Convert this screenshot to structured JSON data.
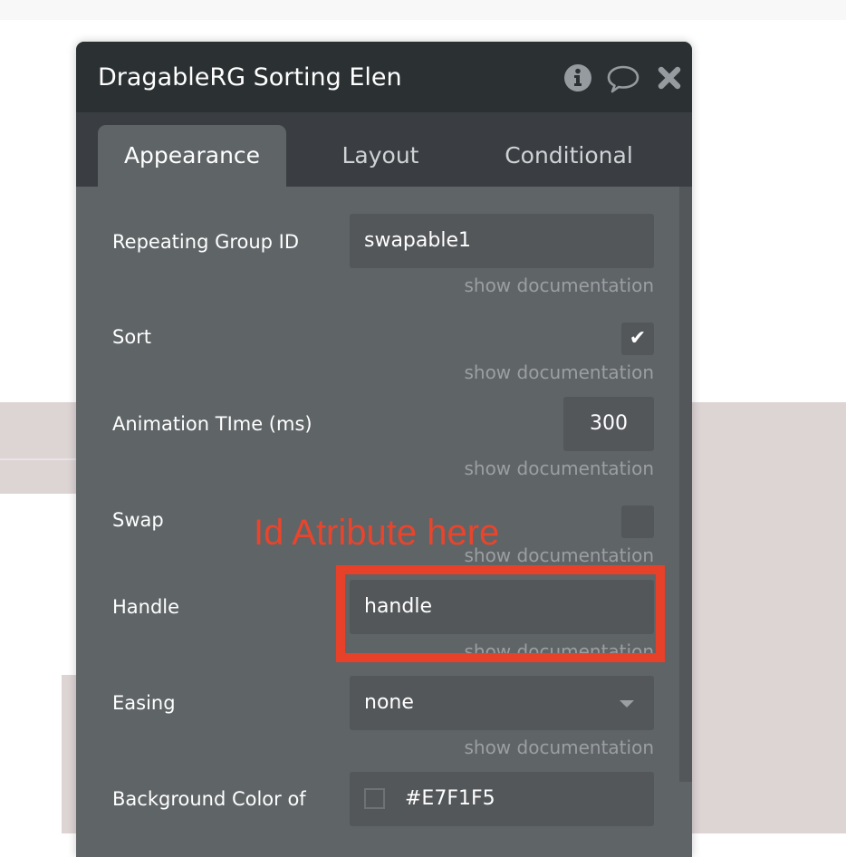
{
  "window": {
    "title": "DragableRG Sorting Elen",
    "header_icons": [
      "info-icon",
      "comment-icon",
      "close-icon"
    ]
  },
  "tabs": [
    {
      "label": "Appearance",
      "active": true
    },
    {
      "label": "Layout",
      "active": false
    },
    {
      "label": "Conditional",
      "active": false
    }
  ],
  "fields": {
    "repeating_group_id": {
      "label": "Repeating Group ID",
      "value": "swapable1",
      "doc": "show documentation"
    },
    "sort": {
      "label": "Sort",
      "checked": true,
      "doc": "show documentation"
    },
    "animation_time": {
      "label": "Animation TIme (ms)",
      "value": "300",
      "doc": "show documentation"
    },
    "swap": {
      "label": "Swap",
      "checked": false,
      "doc": "show documentation"
    },
    "handle": {
      "label": "Handle",
      "value": "handle",
      "doc": "show documentation"
    },
    "easing": {
      "label": "Easing",
      "value": "none",
      "doc": "show documentation"
    },
    "background_color": {
      "label": "Background Color of",
      "value": "#E7F1F5"
    }
  },
  "annotation": {
    "text": "Id Atribute here",
    "color": "#e8452c"
  },
  "colors": {
    "titlebar": "#2b3033",
    "tabbar": "#3a3e42",
    "panel": "#5f6467",
    "input": "#53575a",
    "doc_link": "#9b9fa2",
    "background_band": "#ddd4d4"
  }
}
